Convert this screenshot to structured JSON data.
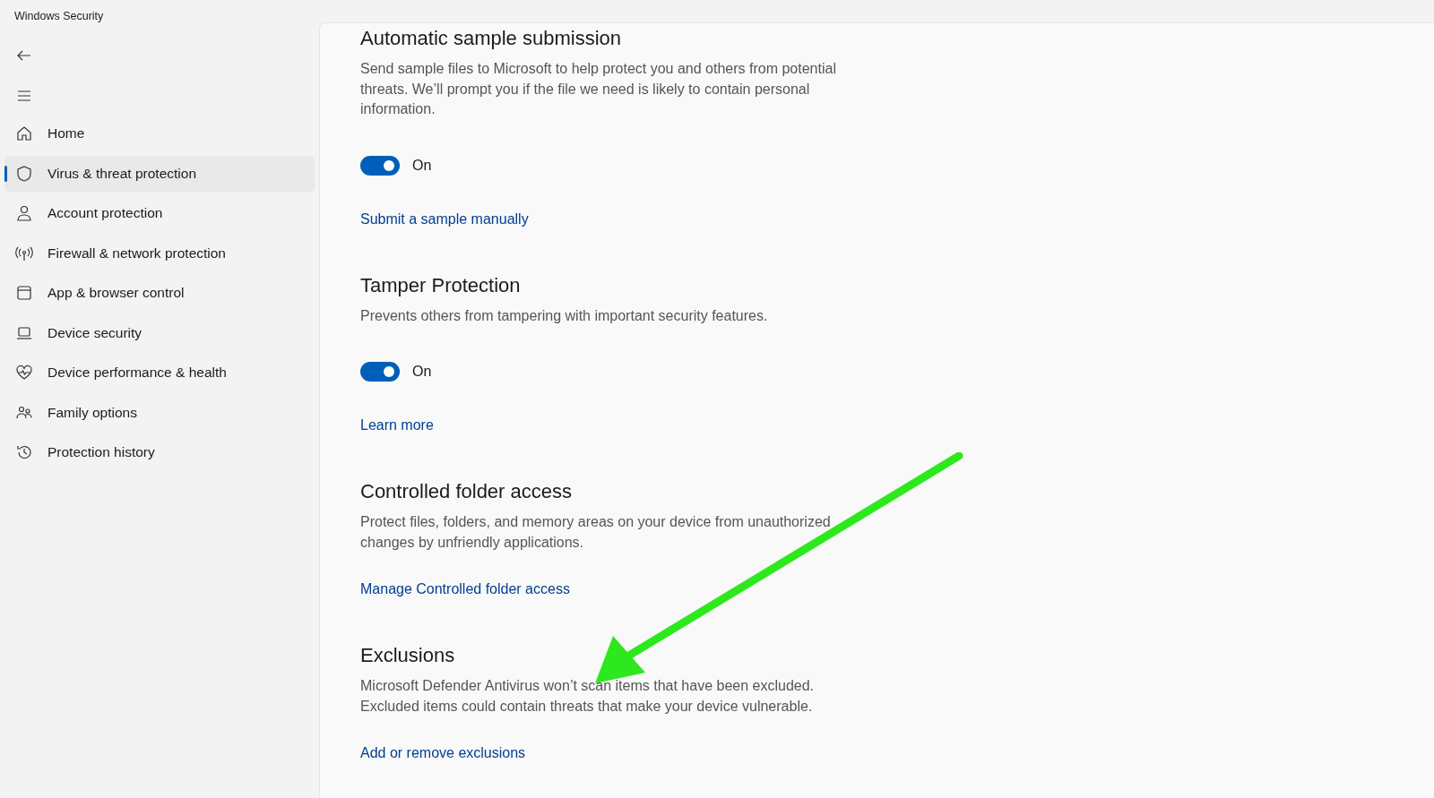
{
  "window": {
    "title": "Windows Security"
  },
  "sidebar": {
    "items": [
      {
        "label": "Home",
        "selected": false
      },
      {
        "label": "Virus & threat protection",
        "selected": true
      },
      {
        "label": "Account protection",
        "selected": false
      },
      {
        "label": "Firewall & network protection",
        "selected": false
      },
      {
        "label": "App & browser control",
        "selected": false
      },
      {
        "label": "Device security",
        "selected": false
      },
      {
        "label": "Device performance & health",
        "selected": false
      },
      {
        "label": "Family options",
        "selected": false
      },
      {
        "label": "Protection history",
        "selected": false
      }
    ]
  },
  "sections": [
    {
      "title": "Automatic sample submission",
      "description": "Send sample files to Microsoft to help protect you and others from potential threats. We’ll prompt you if the file we need is likely to contain personal information.",
      "toggle": {
        "on": true,
        "label": "On"
      },
      "link": "Submit a sample manually"
    },
    {
      "title": "Tamper Protection",
      "description": "Prevents others from tampering with important security features.",
      "toggle": {
        "on": true,
        "label": "On"
      },
      "link": "Learn more"
    },
    {
      "title": "Controlled folder access",
      "description": "Protect files, folders, and memory areas on your device from unauthorized changes by unfriendly applications.",
      "link": "Manage Controlled folder access"
    },
    {
      "title": "Exclusions",
      "description": "Microsoft Defender Antivirus won’t scan items that have been excluded. Excluded items could contain threats that make your device vulnerable.",
      "link": "Add or remove exclusions"
    }
  ]
}
